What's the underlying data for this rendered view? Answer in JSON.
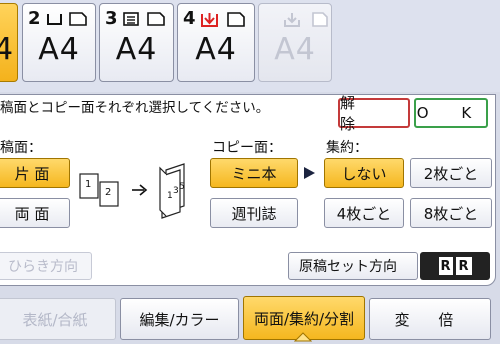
{
  "trays": [
    {
      "num": "",
      "size": "4",
      "state": "selected"
    },
    {
      "num": "2",
      "size": "A4",
      "state": "normal"
    },
    {
      "num": "3",
      "size": "A4",
      "state": "normal"
    },
    {
      "num": "4",
      "size": "A4",
      "state": "normal"
    },
    {
      "num": "",
      "size": "A4",
      "state": "disabled"
    }
  ],
  "message": "稿面とコピー面それぞれ選択してください。",
  "cancel_label": "解 除",
  "ok_label": "O K",
  "original": {
    "label": "稿面：",
    "options": [
      "片 面",
      "両 面"
    ]
  },
  "copy": {
    "label": "コピー面：",
    "options": [
      "ミニ本",
      "週刊誌"
    ]
  },
  "combine": {
    "label": "集約：",
    "options": [
      "しない",
      "2枚ごと",
      "4枚ごと",
      "8枚ごと"
    ]
  },
  "illustration": {
    "page1": "1",
    "page2": "2",
    "book_pages": [
      "1",
      "3",
      "5"
    ]
  },
  "opening_direction_label": "ひらき方向",
  "orientation_label": "原稿セット方向",
  "orientation_icons": [
    "R",
    "R"
  ],
  "tabs": [
    "表紙/合紙",
    "編集/カラー",
    "両面/集約/分割",
    "変 倍"
  ],
  "colors": {
    "accent": "#f5b71f",
    "cancel": "#c43a3a",
    "ok": "#3aa04a"
  }
}
